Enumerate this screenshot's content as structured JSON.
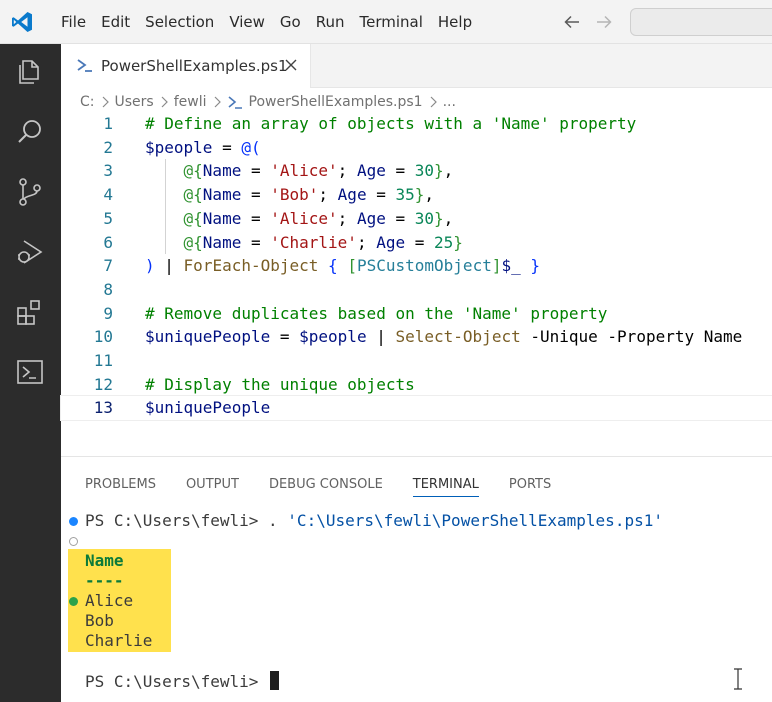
{
  "menu": {
    "items": [
      "File",
      "Edit",
      "Selection",
      "View",
      "Go",
      "Run",
      "Terminal",
      "Help"
    ]
  },
  "tab": {
    "label": "PowerShellExamples.ps1"
  },
  "breadcrumb": {
    "parts": [
      "C:",
      "Users",
      "fewli",
      "PowerShellExamples.ps1",
      "..."
    ]
  },
  "editor": {
    "line_numbers": [
      "1",
      "2",
      "3",
      "4",
      "5",
      "6",
      "7",
      "8",
      "9",
      "10",
      "11",
      "12",
      "13"
    ],
    "lines": [
      [
        {
          "t": "# Define an array of objects with a 'Name' property",
          "c": "comment"
        }
      ],
      [
        {
          "t": "$people",
          "c": "var"
        },
        {
          "t": " = ",
          "c": "op"
        },
        {
          "t": "@(",
          "c": "paren"
        }
      ],
      [
        {
          "t": "    @{",
          "c": "brace"
        },
        {
          "t": "Name",
          "c": "var"
        },
        {
          "t": " = ",
          "c": "op"
        },
        {
          "t": "'Alice'",
          "c": "str"
        },
        {
          "t": "; ",
          "c": "op"
        },
        {
          "t": "Age",
          "c": "var"
        },
        {
          "t": " = ",
          "c": "op"
        },
        {
          "t": "30",
          "c": "num"
        },
        {
          "t": "}",
          "c": "brace"
        },
        {
          "t": ",",
          "c": "op"
        }
      ],
      [
        {
          "t": "    @{",
          "c": "brace"
        },
        {
          "t": "Name",
          "c": "var"
        },
        {
          "t": " = ",
          "c": "op"
        },
        {
          "t": "'Bob'",
          "c": "str"
        },
        {
          "t": "; ",
          "c": "op"
        },
        {
          "t": "Age",
          "c": "var"
        },
        {
          "t": " = ",
          "c": "op"
        },
        {
          "t": "35",
          "c": "num"
        },
        {
          "t": "}",
          "c": "brace"
        },
        {
          "t": ",",
          "c": "op"
        }
      ],
      [
        {
          "t": "    @{",
          "c": "brace"
        },
        {
          "t": "Name",
          "c": "var"
        },
        {
          "t": " = ",
          "c": "op"
        },
        {
          "t": "'Alice'",
          "c": "str"
        },
        {
          "t": "; ",
          "c": "op"
        },
        {
          "t": "Age",
          "c": "var"
        },
        {
          "t": " = ",
          "c": "op"
        },
        {
          "t": "30",
          "c": "num"
        },
        {
          "t": "}",
          "c": "brace"
        },
        {
          "t": ",",
          "c": "op"
        }
      ],
      [
        {
          "t": "    @{",
          "c": "brace"
        },
        {
          "t": "Name",
          "c": "var"
        },
        {
          "t": " = ",
          "c": "op"
        },
        {
          "t": "'Charlie'",
          "c": "str"
        },
        {
          "t": "; ",
          "c": "op"
        },
        {
          "t": "Age",
          "c": "var"
        },
        {
          "t": " = ",
          "c": "op"
        },
        {
          "t": "25",
          "c": "num"
        },
        {
          "t": "}",
          "c": "brace"
        }
      ],
      [
        {
          "t": ")",
          "c": "paren"
        },
        {
          "t": " | ",
          "c": "op"
        },
        {
          "t": "ForEach-Object",
          "c": "cmd"
        },
        {
          "t": " ",
          "c": "op"
        },
        {
          "t": "{",
          "c": "paren"
        },
        {
          "t": " ",
          "c": "op"
        },
        {
          "t": "[",
          "c": "brace"
        },
        {
          "t": "PSCustomObject",
          "c": "type"
        },
        {
          "t": "]",
          "c": "brace"
        },
        {
          "t": "$_",
          "c": "var"
        },
        {
          "t": " ",
          "c": "op"
        },
        {
          "t": "}",
          "c": "paren"
        }
      ],
      [],
      [
        {
          "t": "# Remove duplicates based on the 'Name' property",
          "c": "comment"
        }
      ],
      [
        {
          "t": "$uniquePeople",
          "c": "var"
        },
        {
          "t": " = ",
          "c": "op"
        },
        {
          "t": "$people",
          "c": "var"
        },
        {
          "t": " | ",
          "c": "op"
        },
        {
          "t": "Select-Object",
          "c": "cmd"
        },
        {
          "t": " -Unique -Property Name",
          "c": "plain"
        }
      ],
      [],
      [
        {
          "t": "# Display the unique objects",
          "c": "comment"
        }
      ],
      [
        {
          "t": "$uniquePeople",
          "c": "var"
        }
      ]
    ]
  },
  "panel": {
    "tabs": [
      "PROBLEMS",
      "OUTPUT",
      "DEBUG CONSOLE",
      "TERMINAL",
      "PORTS"
    ],
    "active_tab": "TERMINAL"
  },
  "terminal": {
    "prompt": "PS C:\\Users\\fewli>",
    "command_op": " . ",
    "command_arg": "'C:\\Users\\fewli\\PowerShellExamples.ps1'",
    "header": "Name",
    "underline": "----",
    "rows": [
      "Alice",
      "Bob",
      "Charlie"
    ],
    "final_prompt": "PS C:\\Users\\fewli>"
  },
  "colors": {
    "activity_bar": "#2c2c2c",
    "highlight": "#ffe14d",
    "accent": "#005fb8"
  }
}
